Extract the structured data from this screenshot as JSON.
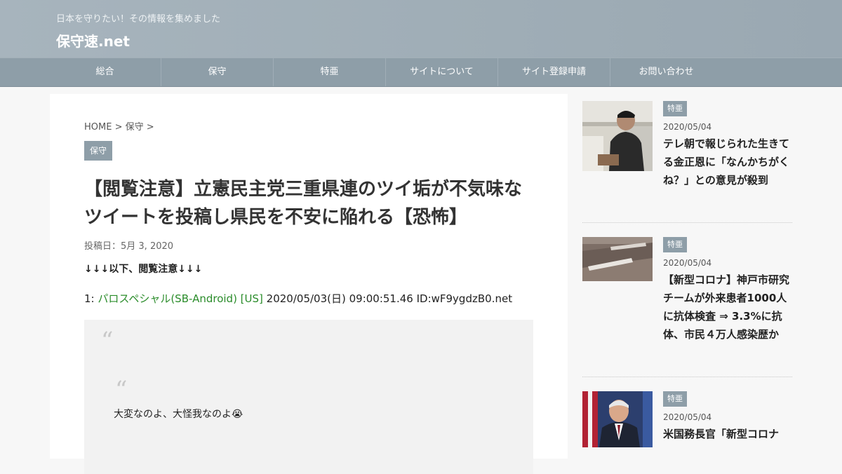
{
  "header": {
    "tagline": "日本を守りたい！その情報を集めました",
    "site_title": "保守速.net"
  },
  "nav": {
    "items": [
      "総合",
      "保守",
      "特亜",
      "サイトについて",
      "サイト登録申請",
      "お問い合わせ"
    ]
  },
  "article": {
    "breadcrumb": "HOME > 保守 >",
    "category": "保守",
    "title": "【閲覧注意】立憲民主党三重県連のツイ垢が不気味なツイートを投稿し県民を不安に陥れる【恐怖】",
    "post_date": "投稿日：5月 3, 2020",
    "notice": "↓↓↓以下、閲覧注意↓↓↓",
    "post": {
      "number": "1: ",
      "name": "パロスペシャル(SB-Android) [US]",
      "meta": " 2020/05/03(日) 09:00:51.46 ID:wF9ygdzB0.net"
    },
    "quote_mark": "“",
    "quote_text": "大変なのよ、大怪我なのよ😭"
  },
  "sidebar": {
    "items": [
      {
        "category": "特亜",
        "date": "2020/05/04",
        "title": "テレ朝で報じられた生きてる金正恩に「なんかちがくね？」との意見が殺到"
      },
      {
        "category": "特亜",
        "date": "2020/05/04",
        "title": "【新型コロナ】神戸市研究チームが外来患者1000人に抗体検査 ⇒ 3.3%に抗体、市民４万人感染歴か"
      },
      {
        "category": "特亜",
        "date": "2020/05/04",
        "title": "米国務長官「新型コロナ"
      }
    ]
  }
}
